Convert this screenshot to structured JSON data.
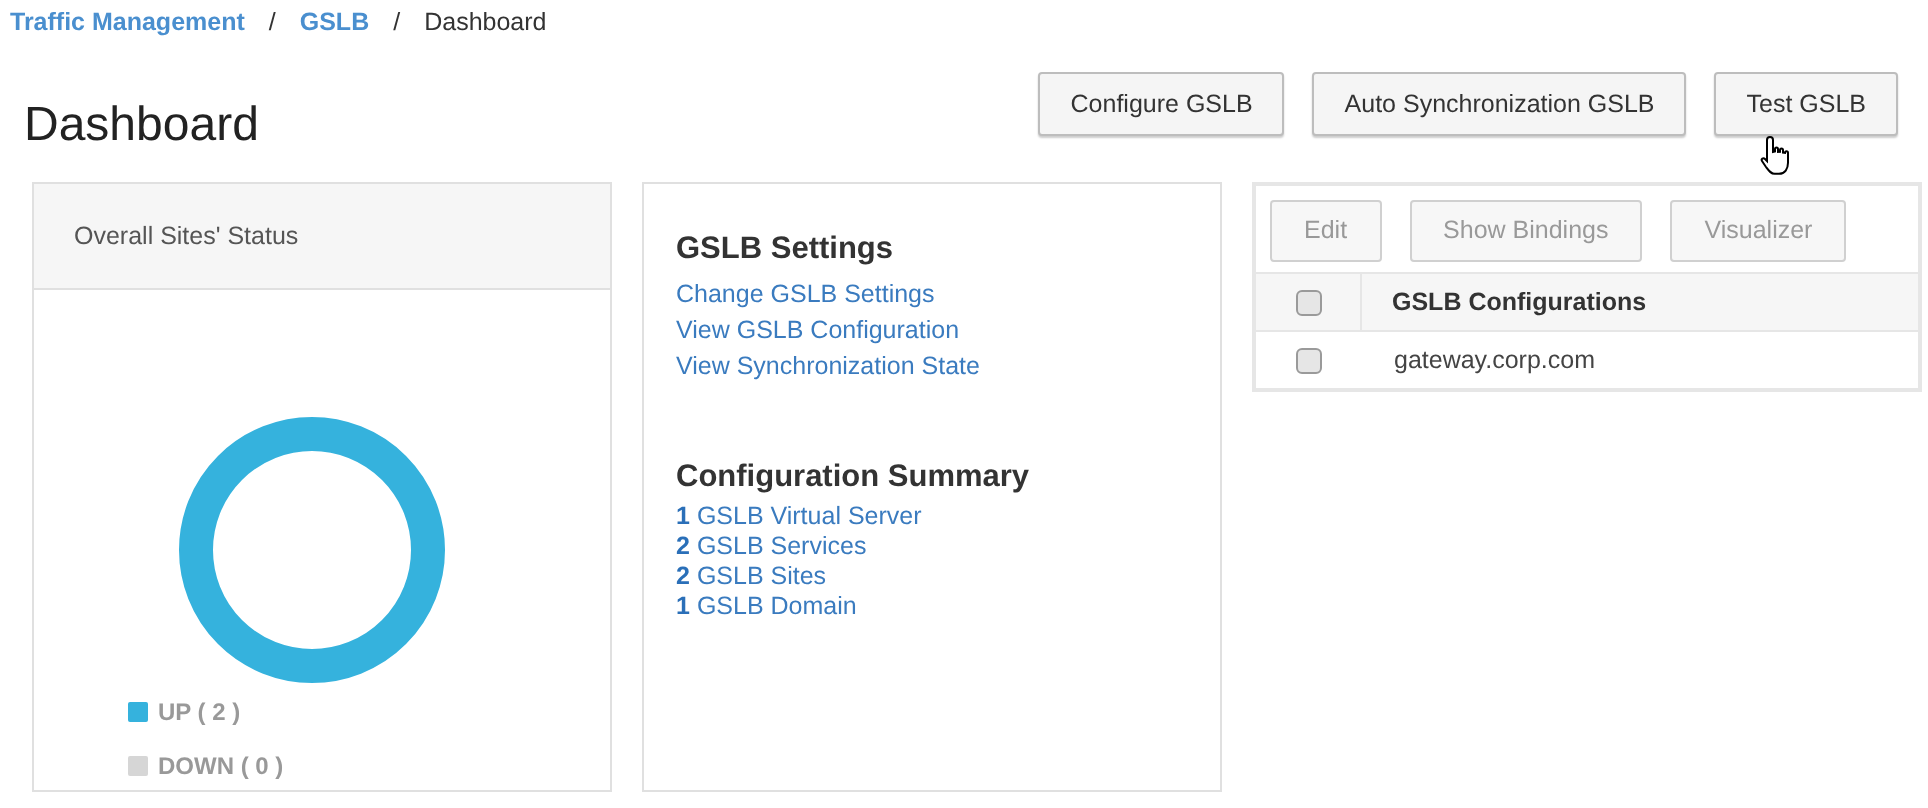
{
  "breadcrumb": [
    {
      "label": "Traffic Management",
      "link": true
    },
    {
      "label": "GSLB",
      "link": true
    },
    {
      "label": "Dashboard",
      "link": false
    }
  ],
  "breadcrumb_separator": "/",
  "title": "Dashboard",
  "actions": [
    "Configure GSLB",
    "Auto Synchronization GSLB",
    "Test GSLB"
  ],
  "status_panel": {
    "title": "Overall Sites' Status",
    "legend": [
      {
        "label": "UP ( 2 )",
        "color": "#35b2dd"
      },
      {
        "label": "DOWN ( 0 )",
        "color": "#d6d6d6"
      }
    ]
  },
  "settings_panel": {
    "title": "GSLB Settings",
    "links": [
      "Change GSLB Settings",
      "View GSLB Configuration",
      "View Synchronization State"
    ],
    "summary_title": "Configuration Summary",
    "summary": [
      {
        "count": "1",
        "label": "GSLB Virtual Server"
      },
      {
        "count": "2",
        "label": "GSLB Services"
      },
      {
        "count": "2",
        "label": "GSLB Sites"
      },
      {
        "count": "1",
        "label": "GSLB Domain"
      }
    ]
  },
  "table": {
    "toolbar": [
      {
        "label": "Edit",
        "disabled": true
      },
      {
        "label": "Show Bindings",
        "disabled": true
      },
      {
        "label": "Visualizer",
        "disabled": true
      }
    ],
    "columns": [
      "GSLB Configurations"
    ],
    "header_checked": false,
    "rows": [
      {
        "cells": [
          "gateway.corp.com"
        ],
        "checked": false
      }
    ]
  }
}
